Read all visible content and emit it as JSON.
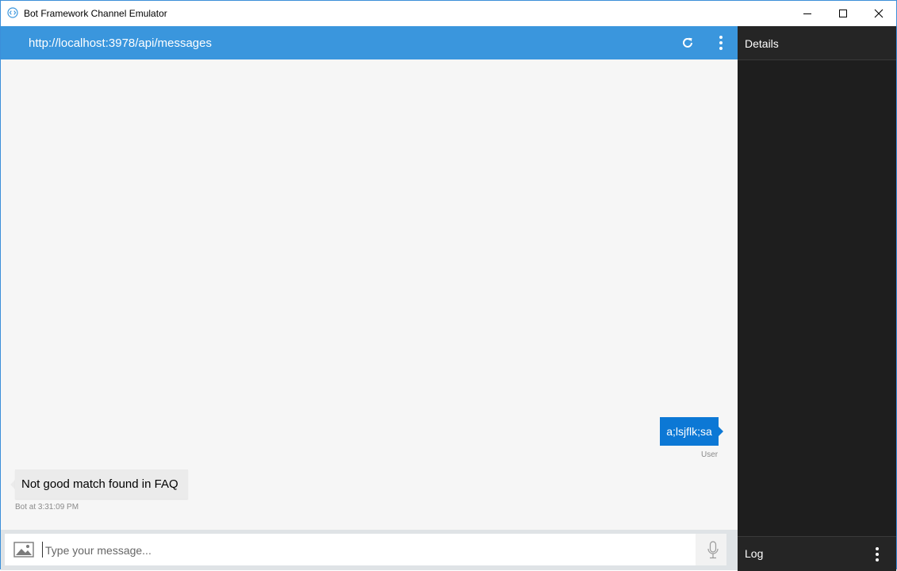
{
  "window": {
    "title": "Bot Framework Channel Emulator",
    "controls": {
      "minimize": "minimize-icon",
      "maximize": "maximize-icon",
      "close": "close-icon"
    }
  },
  "addressbar": {
    "url": "http://localhost:3978/api/messages",
    "icons": {
      "refresh": "refresh-icon",
      "menu": "more-vertical-icon"
    },
    "color": "#3a96dd"
  },
  "conversation": {
    "messages": [
      {
        "from": "user",
        "text": "a;lsjflk;sa",
        "meta": "User"
      },
      {
        "from": "bot",
        "text": "Not good match found in FAQ",
        "meta": "Bot at 3:31:09 PM"
      }
    ],
    "user_bubble_color": "#0c78d5"
  },
  "composer": {
    "placeholder": "Type your message...",
    "value": "",
    "icons": {
      "attach": "image-icon",
      "mic": "microphone-icon"
    }
  },
  "details_panel": {
    "title": "Details",
    "log_title": "Log"
  }
}
